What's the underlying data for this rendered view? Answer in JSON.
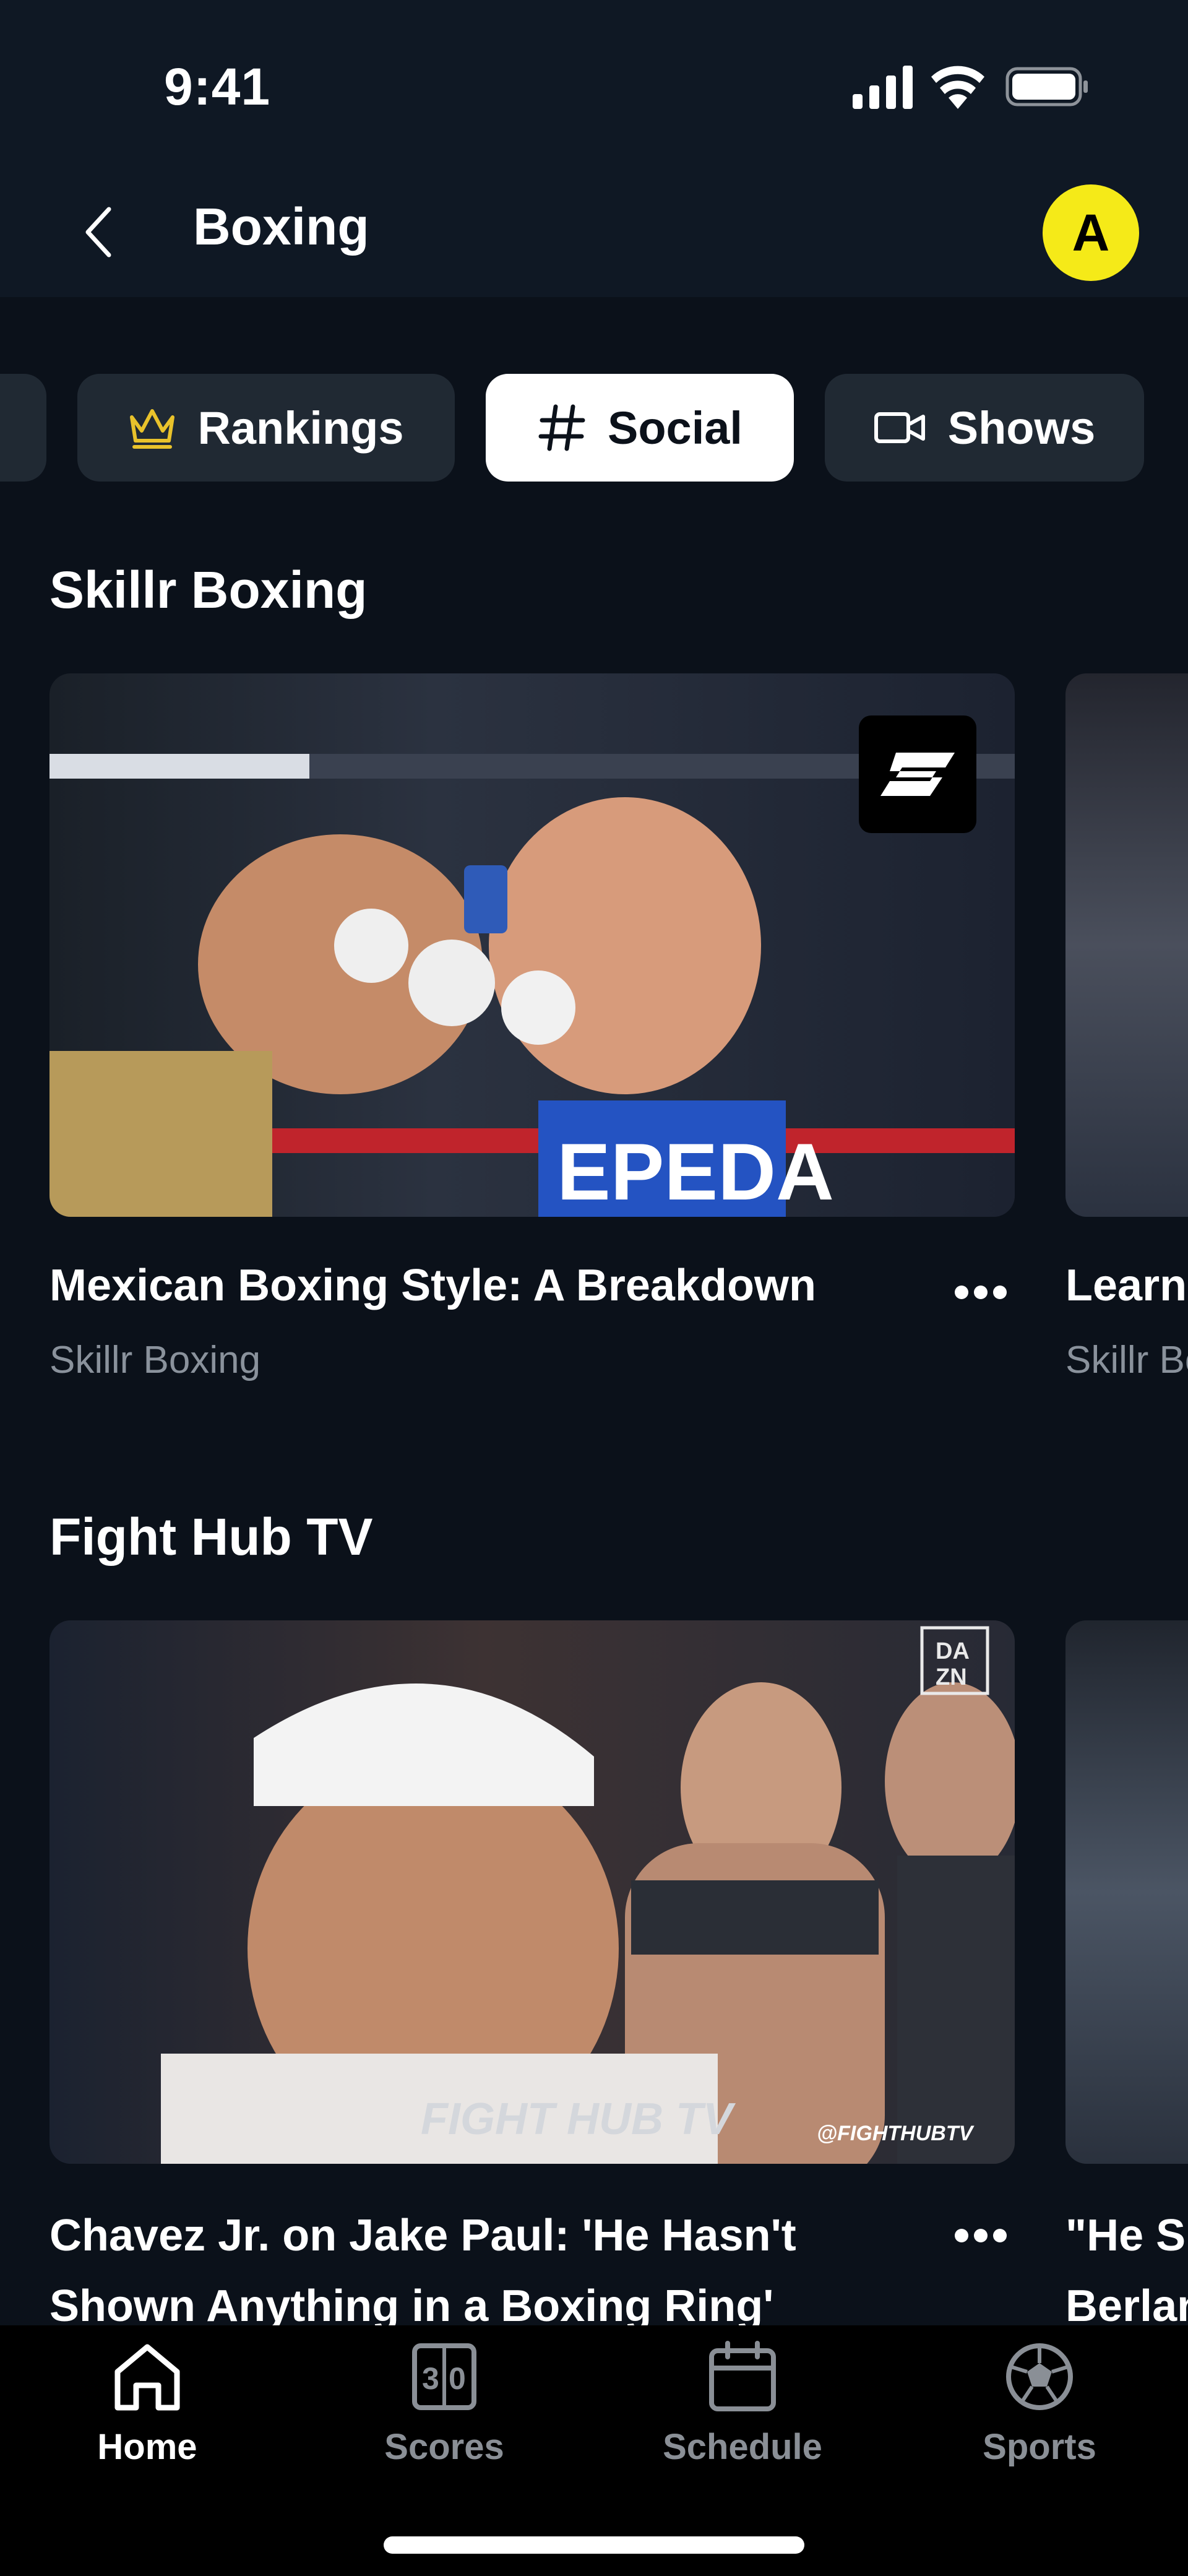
{
  "status_bar": {
    "time": "9:41"
  },
  "header": {
    "title": "Boxing",
    "avatar_initial": "A"
  },
  "chips": [
    {
      "label": "Rankings",
      "icon": "crown-icon",
      "active": false
    },
    {
      "label": "Social",
      "icon": "hashtag-icon",
      "active": true
    },
    {
      "label": "Shows",
      "icon": "video-camera-icon",
      "active": false
    }
  ],
  "sections": [
    {
      "title": "Skillr Boxing",
      "card": {
        "title": "Mexican Boxing Style: A Breakdown",
        "subtitle": "Skillr Boxing"
      },
      "peek": {
        "title": "Learn",
        "subtitle": "Skillr Bo"
      }
    },
    {
      "title": "Fight Hub TV",
      "card": {
        "title": "Chavez Jr. on Jake Paul: 'He Hasn't Shown Anything in a Boxing Ring'"
      },
      "peek": {
        "title_line1": "\"He Sh",
        "title_line2": "Berlan"
      }
    }
  ],
  "tabs": [
    {
      "label": "Home",
      "icon": "home-icon",
      "active": true
    },
    {
      "label": "Scores",
      "icon": "scoreboard-icon",
      "active": false
    },
    {
      "label": "Schedule",
      "icon": "calendar-icon",
      "active": false
    },
    {
      "label": "Sports",
      "icon": "soccer-ball-icon",
      "active": false
    }
  ],
  "colors": {
    "background": "#0b111a",
    "header": "#0f1824",
    "chip": "#202933",
    "accent": "#f5ea18",
    "muted": "#8a929c"
  }
}
